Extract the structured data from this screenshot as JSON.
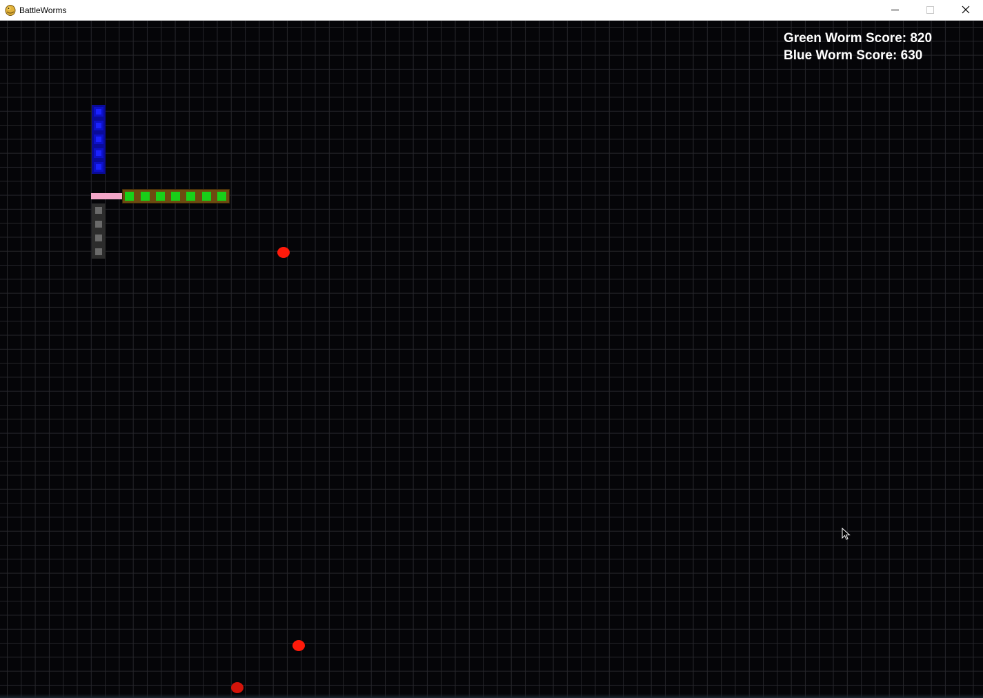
{
  "window": {
    "title": "BattleWorms",
    "app_icon": "pygame-snake-icon",
    "controls": [
      "minimize-icon",
      "maximize-icon",
      "close-icon"
    ]
  },
  "scoreboard": {
    "green_score_text": "Green Worm Score: 820",
    "blue_score_text": "Blue Worm Score: 630",
    "green_score": 820,
    "blue_score": 630
  },
  "colors": {
    "blue_worm": "#0d11c8",
    "green_worm": "#19d019",
    "green_worm_body": "#6e4a10",
    "pink_segment": "#f3a6c8",
    "gray_worm": "#6a6a6a",
    "food": "#ff1a0a",
    "grid": "#26262b",
    "background": "#050508"
  },
  "pieces": {
    "blue_worm_segments": 5,
    "green_worm_segments": 7,
    "gray_worm_segments": 4,
    "food_items": 3
  }
}
